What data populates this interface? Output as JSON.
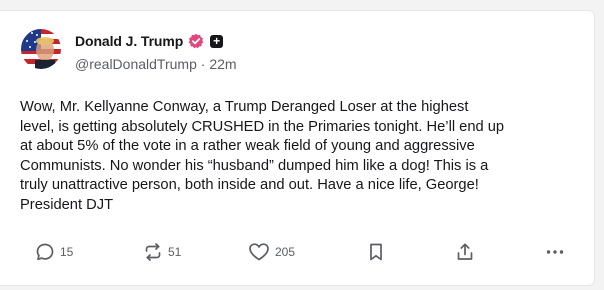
{
  "post": {
    "author": {
      "display_name": "Donald J. Trump",
      "handle": "@realDonaldTrump",
      "age": "22m",
      "verified_icon": "verified-badge-icon",
      "extra_badge_icon": "plus-icon"
    },
    "text": "Wow, Mr. Kellyanne Conway, a Trump Deranged Loser at the highest\nlevel, is getting absolutely CRUSHED in the Primaries tonight. He’ll end up\nat about 5% of the vote in a rather weak field of young and aggressive\nCommunists. No wonder his “husband” dumped him like a dog! This is a\ntruly unattractive person, both inside and out. Have a nice life, George!\nPresident DJT",
    "actions": {
      "replies": "15",
      "reposts": "51",
      "likes": "205"
    }
  },
  "colors": {
    "text": "#17171a",
    "muted": "#5c5e66",
    "verified": "#e0487d"
  }
}
